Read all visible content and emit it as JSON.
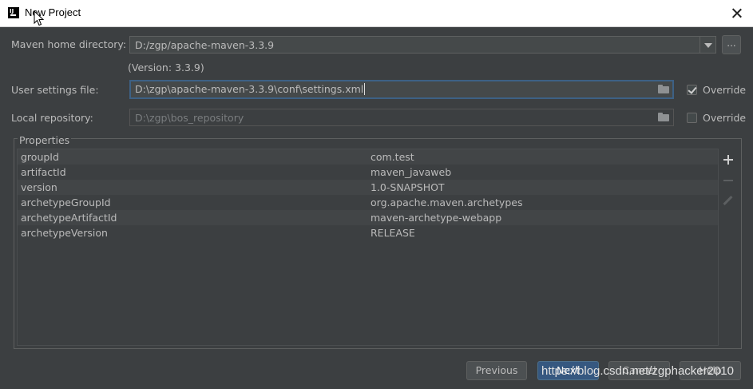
{
  "window": {
    "title": "New Project"
  },
  "maven": {
    "home_label": "Maven home directory:",
    "home_value": "D:/zgp/apache-maven-3.3.9",
    "version_text": "(Version: 3.3.9)",
    "browse_label": "...",
    "settings_label": "User settings file:",
    "settings_value": "D:\\zgp\\apache-maven-3.3.9\\conf\\settings.xml",
    "settings_override_label": "Override",
    "settings_override_checked": true,
    "repo_label": "Local repository:",
    "repo_value": "D:\\zgp\\bos_repository",
    "repo_override_label": "Override",
    "repo_override_checked": false
  },
  "properties": {
    "title": "Properties",
    "rows": [
      {
        "key": "groupId",
        "value": "com.test"
      },
      {
        "key": "artifactId",
        "value": "maven_javaweb"
      },
      {
        "key": "version",
        "value": "1.0-SNAPSHOT"
      },
      {
        "key": "archetypeGroupId",
        "value": "org.apache.maven.archetypes"
      },
      {
        "key": "archetypeArtifactId",
        "value": "maven-archetype-webapp"
      },
      {
        "key": "archetypeVersion",
        "value": "RELEASE"
      }
    ]
  },
  "buttons": {
    "previous": "Previous",
    "next": "Next",
    "cancel": "Cancel",
    "help": "Help"
  },
  "watermark": "https://blog.csdn.net/zgphacker2010",
  "colors": {
    "background": "#3c3f41",
    "field": "#45494a",
    "focus_border": "#3d6185",
    "default_button": "#365880"
  }
}
